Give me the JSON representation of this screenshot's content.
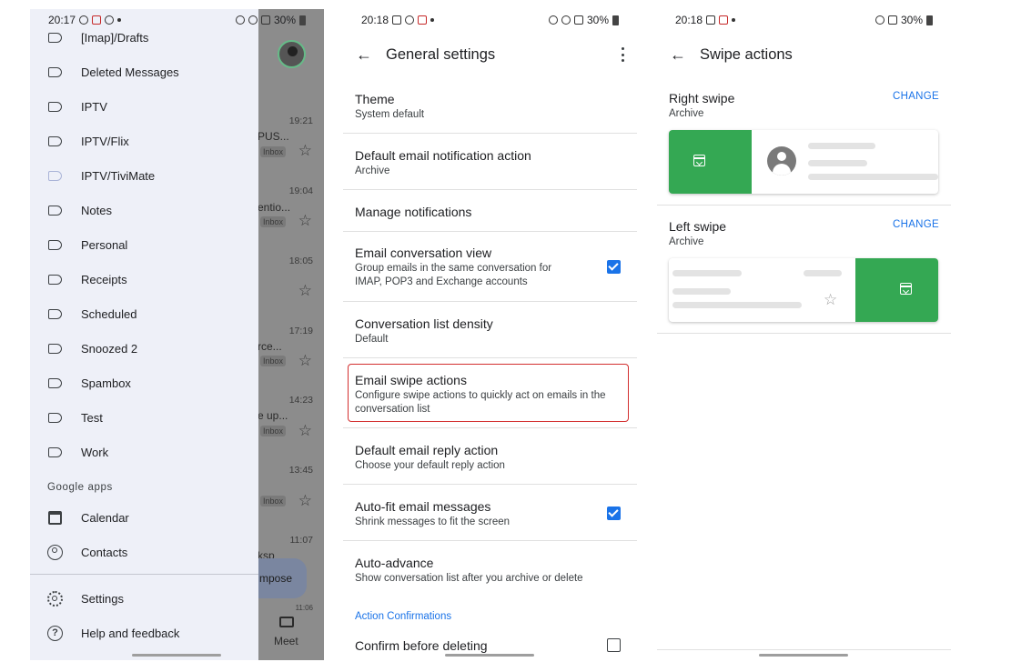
{
  "screen1": {
    "status": {
      "time": "20:17",
      "battery": "30%"
    },
    "drawer": {
      "labels": [
        "[Imap]/Drafts",
        "Deleted Messages",
        "IPTV",
        "IPTV/Flix",
        "IPTV/TiviMate",
        "Notes",
        "Personal",
        "Receipts",
        "Scheduled",
        "Snoozed 2",
        "Spambox",
        "Test",
        "Work"
      ],
      "section_google_apps": "Google apps",
      "calendar": "Calendar",
      "contacts": "Contacts",
      "settings": "Settings",
      "help": "Help and feedback"
    },
    "background": {
      "times": [
        "19:21",
        "19:04",
        "18:05",
        "17:19",
        "14:23",
        "13:45",
        "11:07",
        "11:06"
      ],
      "snippets": [
        "PUS...",
        "entio...",
        "rce...",
        "e up...",
        "ksp"
      ],
      "badge": "Inbox",
      "compose": "mpose",
      "meet": "Meet"
    }
  },
  "screen2": {
    "status": {
      "time": "20:18",
      "battery": "30%"
    },
    "title": "General settings",
    "settings": [
      {
        "title": "Theme",
        "subtitle": "System default"
      },
      {
        "title": "Default email notification action",
        "subtitle": "Archive"
      },
      {
        "title": "Manage notifications"
      },
      {
        "title": "Email conversation view",
        "subtitle": "Group emails in the same conversation for IMAP, POP3 and Exchange accounts",
        "checked": true
      },
      {
        "title": "Conversation list density",
        "subtitle": "Default"
      },
      {
        "title": "Email swipe actions",
        "subtitle": "Configure swipe actions to quickly act on emails in the conversation list"
      },
      {
        "title": "Default email reply action",
        "subtitle": "Choose your default reply action"
      },
      {
        "title": "Auto-fit email messages",
        "subtitle": "Shrink messages to fit the screen",
        "checked": true
      },
      {
        "title": "Auto-advance",
        "subtitle": "Show conversation list after you archive or delete"
      }
    ],
    "section_header": "Action Confirmations",
    "confirm_delete": "Confirm before deleting"
  },
  "screen3": {
    "status": {
      "time": "20:18",
      "battery": "30%"
    },
    "title": "Swipe actions",
    "right": {
      "title": "Right swipe",
      "value": "Archive",
      "change": "CHANGE"
    },
    "left": {
      "title": "Left swipe",
      "value": "Archive",
      "change": "CHANGE"
    }
  },
  "colors": {
    "accent": "#1a73e8",
    "swipe_green": "#34a853",
    "highlight": "#d32f2f",
    "drawer_bg": "#eef0f8"
  }
}
